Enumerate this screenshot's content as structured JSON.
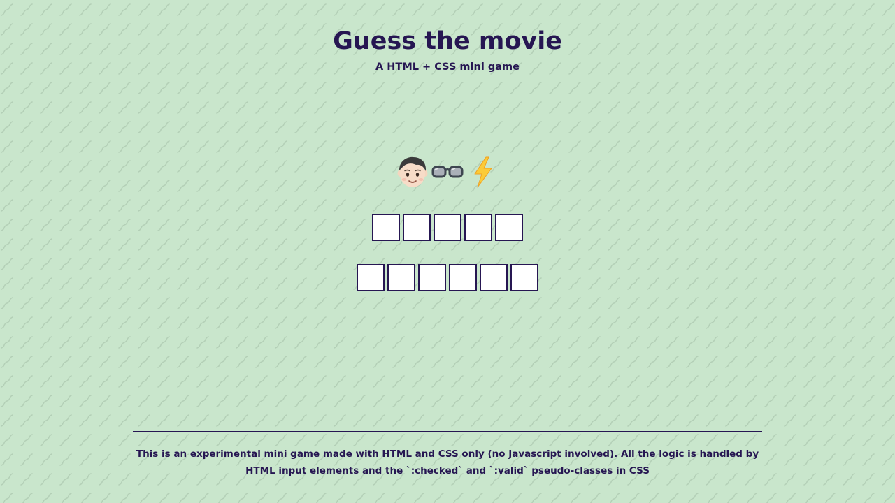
{
  "header": {
    "title": "Guess the movie",
    "subtitle": "A HTML + CSS mini game"
  },
  "puzzle": {
    "clue_icons": [
      "boy-face-icon",
      "glasses-icon",
      "lightning-bolt-icon"
    ],
    "words": [
      {
        "letter_count": 5
      },
      {
        "letter_count": 6
      }
    ]
  },
  "footer": {
    "description": "This is an experimental mini game made with HTML and CSS only (no Javascript involved). All the logic is handled by HTML input elements and the `:checked` and `:valid` pseudo-classes in CSS"
  },
  "colors": {
    "background": "#c9e6cc",
    "pattern": "#b2cdb5",
    "text": "#261652",
    "box_border": "#261652",
    "box_fill": "#ffffff"
  }
}
